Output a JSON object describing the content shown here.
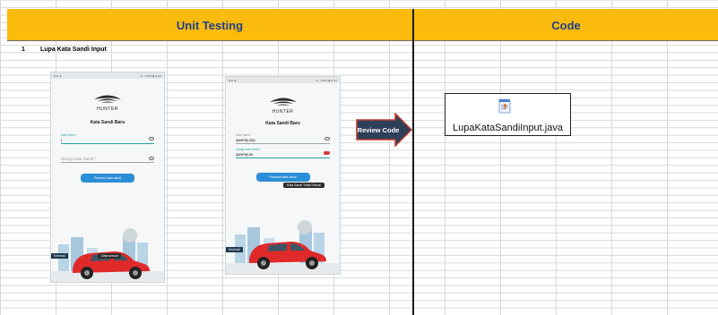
{
  "header": {
    "left_title": "Unit Testing",
    "right_title": "Code"
  },
  "row": {
    "number": "1",
    "title": "Lupa Kata Sandi Input"
  },
  "phone1": {
    "status_left": "◘ ⊕ ⊕",
    "status_right": "⁂ .ıl 55% ▮ 11:34",
    "brand": "HUNTER",
    "screen_title": "Kata Sandi Baru",
    "field1_label": "Kata Sandi *",
    "field2_placeholder": "Ulangi Kata Sandi *",
    "button": "Perbarui kata sandi",
    "back_label": "Kembali",
    "toast": "Data sesuai"
  },
  "phone2": {
    "status_left": "◘ ⊕ ⊕",
    "status_right": "⁂ .ıl 55% ▮ 11:34",
    "brand": "HUNTER",
    "screen_title": "Kata Sandi Baru",
    "field1_label": "Kata Sandi *",
    "field1_value": "qwertyuiop",
    "field2_label": "Ulangi Kata Sandi *",
    "field2_value": "qwertyuio",
    "error_tooltip": "Kata Sandi Tidak Sesuai",
    "button": "Perbarui kata sandi",
    "back_label": "Kembali"
  },
  "arrow_label": "Review Code",
  "file": {
    "name": "LupaKataSandiInput.java",
    "icon": "java-file-icon"
  },
  "colors": {
    "header_bg": "#fbbb0d",
    "header_text": "#1f3f8f",
    "arrow_fill": "#2e3f59",
    "arrow_border": "#c0392b",
    "car": "#e02a2a",
    "button": "#2b8ed6"
  }
}
